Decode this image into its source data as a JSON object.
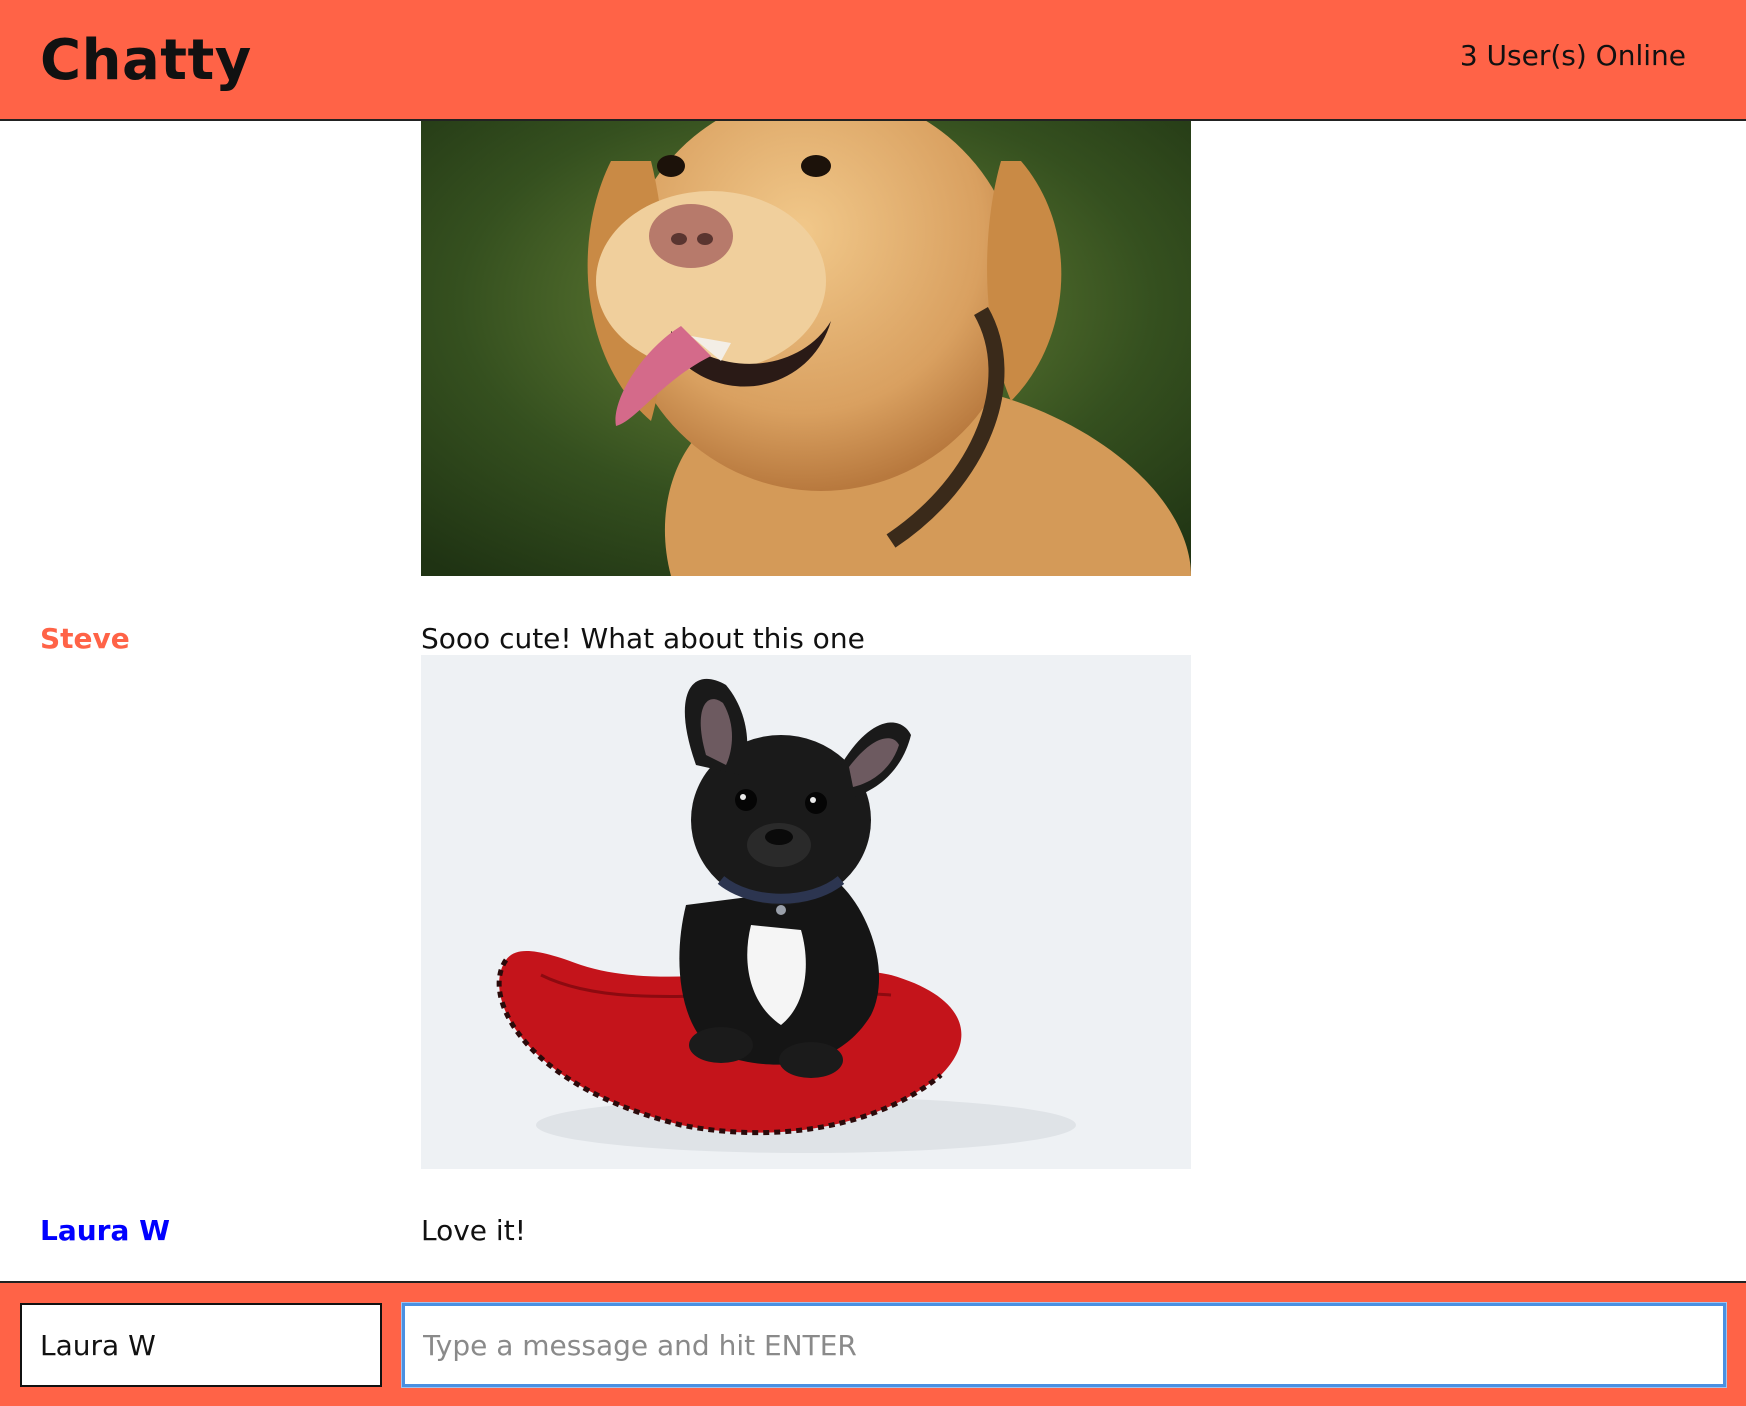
{
  "header": {
    "brand": "Chatty",
    "online_count": "3 User(s) Online"
  },
  "colors": {
    "accent": "#ff6347",
    "steve": "#ff6347",
    "laura": "#0000ff",
    "focus_ring": "#4a90e2"
  },
  "messages": [
    {
      "username": "",
      "content": "",
      "image": "golden-retriever-photo"
    },
    {
      "username": "Steve",
      "content": "Sooo cute! What about this one",
      "image": "french-bulldog-photo"
    },
    {
      "username": "Laura W",
      "content": "Love it!"
    }
  ],
  "chatbar": {
    "username_value": "Laura W",
    "message_placeholder": "Type a message and hit ENTER"
  }
}
